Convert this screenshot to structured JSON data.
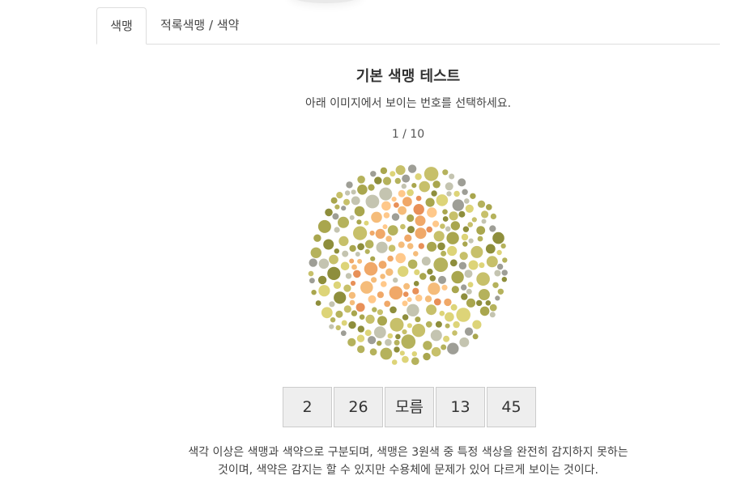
{
  "tabs": [
    {
      "label": "색맹",
      "active": true
    },
    {
      "label": "적록색맹 / 색약",
      "active": false
    }
  ],
  "test": {
    "title": "기본 색맹 테스트",
    "instruction": "아래 이미지에서 보이는 번호를 선택하세요.",
    "progress": "1 / 10",
    "answers": [
      "2",
      "26",
      "모름",
      "13",
      "45"
    ],
    "description_lines": [
      "색각 이상은 색맹과 색약으로 구분되며, 색맹은 3원색 중 특정 색상을 완전히 감지하지 못하는",
      "것이며, 색약은 감지는 할 수 있지만 수용체에 문제가 있어 다르게 보이는 것이다."
    ]
  },
  "plate": {
    "background_colors": [
      "#8e8e3c",
      "#a9a64e",
      "#c7c06a",
      "#ddd478",
      "#9e9e96",
      "#c4c4b0",
      "#b5b25c"
    ],
    "figure_colors": [
      "#f0a868",
      "#e89058",
      "#f5bc7a",
      "#ffc88a"
    ]
  },
  "colors": {
    "tab_border": "#dddddd",
    "button_bg": "#eeeeee",
    "button_border": "#cccccc",
    "text": "#333333"
  }
}
